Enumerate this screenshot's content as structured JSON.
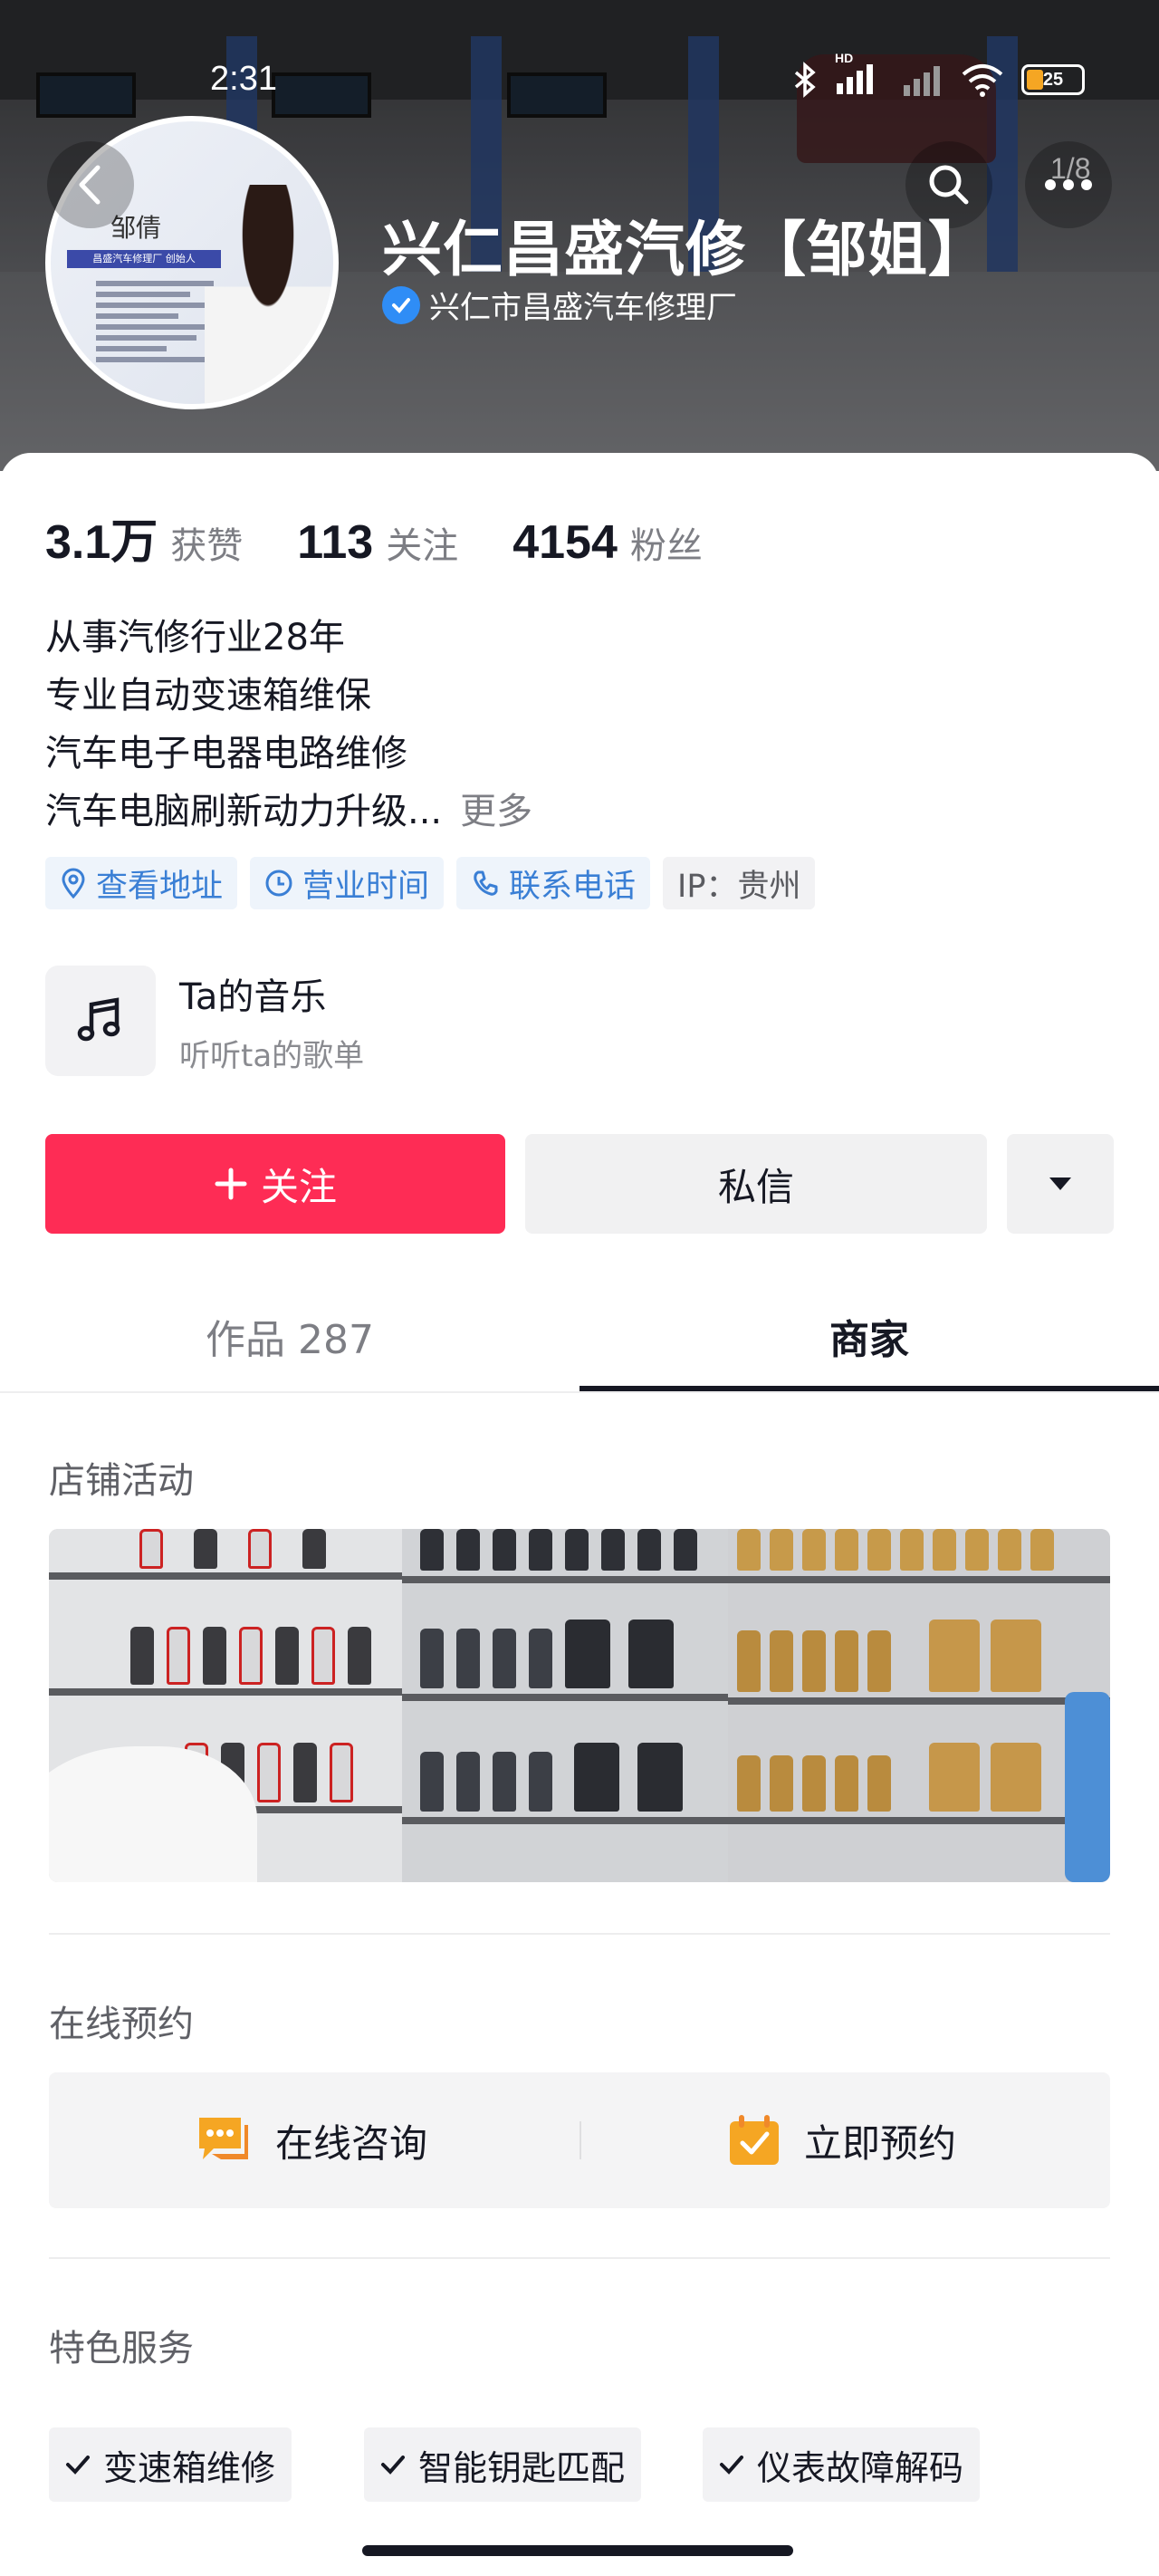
{
  "status_bar": {
    "time": "2:31",
    "battery": "25",
    "network_label": "HD"
  },
  "header": {
    "title": "兴仁昌盛汽修【邹姐】",
    "verified_name": "兴仁市昌盛汽车修理厂",
    "page_counter": "1/8",
    "icons": [
      "back-icon",
      "search-icon",
      "more-icon"
    ]
  },
  "avatar": {
    "name": "邹倩",
    "ribbon": "昌盛汽车修理厂 创始人"
  },
  "stats": [
    {
      "value": "3.1万",
      "label": "获赞"
    },
    {
      "value": "113",
      "label": "关注"
    },
    {
      "value": "4154",
      "label": "粉丝"
    }
  ],
  "bio": {
    "lines": [
      "从事汽修行业28年",
      "专业自动变速箱维保",
      "汽车电子电器电路维修",
      "汽车电脑刷新动力升级..."
    ],
    "more": "更多"
  },
  "tags": [
    {
      "label": "查看地址",
      "icon": "location-icon"
    },
    {
      "label": "营业时间",
      "icon": "clock-icon"
    },
    {
      "label": "联系电话",
      "icon": "phone-icon"
    },
    {
      "label": "IP：贵州"
    }
  ],
  "music": {
    "title": "Ta的音乐",
    "subtitle": "听听ta的歌单"
  },
  "actions": {
    "follow": "关注",
    "message": "私信"
  },
  "tabs": [
    {
      "label": "作品 287"
    },
    {
      "label": "商家"
    }
  ],
  "sections": {
    "store_activity": "店铺活动",
    "online_reservation": "在线预约",
    "featured_services": "特色服务"
  },
  "reservation": {
    "consult": "在线咨询",
    "book": "立即预约"
  },
  "services": [
    "变速箱维修",
    "智能钥匙匹配",
    "仪表故障解码"
  ],
  "colors": {
    "accent": "#fe2c55",
    "link_blue": "#3a7fd5",
    "verify_blue": "#2f8df6",
    "reserve_orange": "#f5a623"
  }
}
